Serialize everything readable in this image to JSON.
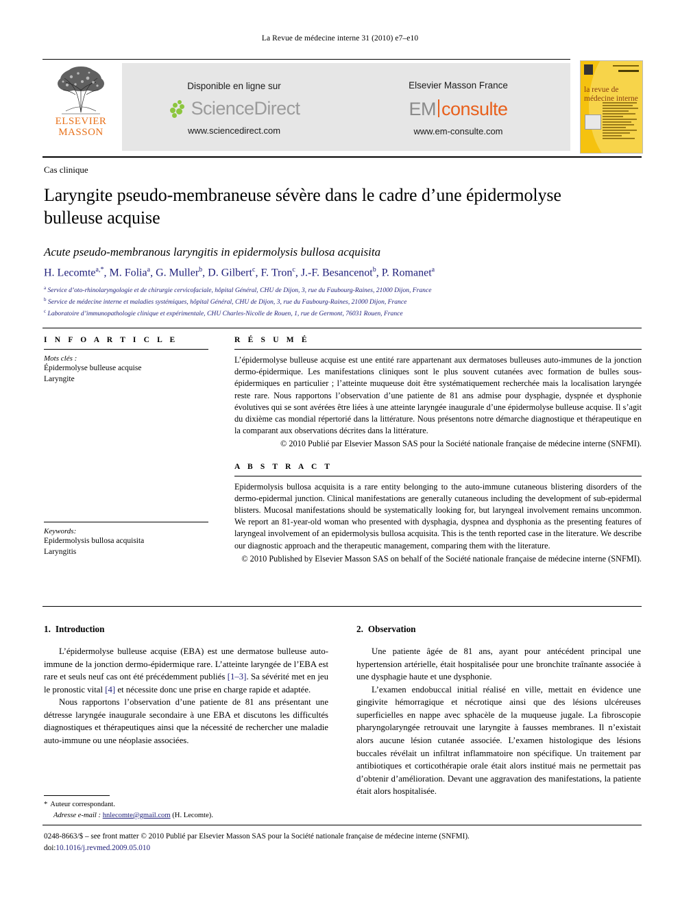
{
  "running_head": "La Revue de médecine interne 31 (2010) e7–e10",
  "banner": {
    "publisher_line1": "ELSEVIER",
    "publisher_line2": "MASSON",
    "sciencedirect": {
      "caption": "Disponible en ligne sur",
      "wordmark": "ScienceDirect",
      "url": "www.sciencedirect.com"
    },
    "emconsulte": {
      "caption": "Elsevier Masson France",
      "wordmark_left": "EM",
      "wordmark_right": "consulte",
      "url": "www.em-consulte.com"
    },
    "cover": {
      "title_line1": "la revue de",
      "title_line2": "médecine interne"
    }
  },
  "article": {
    "type": "Cas clinique",
    "title_fr": "Laryngite pseudo-membraneuse sévère dans le cadre d’une épidermolyse bulleuse acquise",
    "title_en": "Acute pseudo-membranous laryngitis in epidermolysis bullosa acquisita",
    "authors_html": "H. Lecomte<sup>a,*</sup>, M. Folia<sup>a</sup>, G. Muller<sup>b</sup>, D. Gilbert<sup>c</sup>, F. Tron<sup>c</sup>, J.-F. Besancenot<sup>b</sup>, P. Romanet<sup>a</sup>",
    "affiliations": [
      {
        "mark": "a",
        "text": "Service d’oto-rhinolaryngologie et de chirurgie cervicofaciale, hôpital Général, CHU de Dijon, 3, rue du Faubourg-Raines, 21000 Dijon, France"
      },
      {
        "mark": "b",
        "text": "Service de médecine interne et maladies systémiques, hôpital Général, CHU de Dijon, 3, rue du Faubourg-Raines, 21000 Dijon, France"
      },
      {
        "mark": "c",
        "text": "Laboratoire d’immunopathologie clinique et expérimentale, CHU Charles-Nicolle de Rouen, 1, rue de Germont, 76031 Rouen, France"
      }
    ]
  },
  "info_article": {
    "heading": "I N F O   A R T I C L E",
    "keywords_fr_label": "Mots clés :",
    "keywords_fr": [
      "Épidermolyse bulleuse acquise",
      "Laryngite"
    ],
    "keywords_en_label": "Keywords:",
    "keywords_en": [
      "Epidermolysis bullosa acquisita",
      "Laryngitis"
    ]
  },
  "resume": {
    "heading": "R É S U M É",
    "body": "L’épidermolyse bulleuse acquise est une entité rare appartenant aux dermatoses bulleuses auto-immunes de la jonction dermo-épidermique. Les manifestations cliniques sont le plus souvent cutanées avec formation de bulles sous-épidermiques en particulier ; l’atteinte muqueuse doit être systématiquement recherchée mais la localisation laryngée reste rare. Nous rapportons l’observation d’une patiente de 81 ans admise pour dysphagie, dyspnée et dysphonie évolutives qui se sont avérées être liées à une atteinte laryngée inaugurale d’une épidermolyse bulleuse acquise. Il s’agit du dixième cas mondial répertorié dans la littérature. Nous présentons notre démarche diagnostique et thérapeutique en la comparant aux observations décrites dans la littérature.",
    "copyright": "© 2010 Publié par Elsevier Masson SAS pour la Société nationale française de médecine interne (SNFMI)."
  },
  "abstract": {
    "heading": "A B S T R A C T",
    "body": "Epidermolysis bullosa acquisita is a rare entity belonging to the auto-immune cutaneous blistering disorders of the dermo-epidermal junction. Clinical manifestations are generally cutaneous including the development of sub-epidermal blisters. Mucosal manifestations should be systematically looking for, but laryngeal involvement remains uncommon. We report an 81-year-old woman who presented with dysphagia, dyspnea and dysphonia as the presenting features of laryngeal involvement of an epidermolysis bullosa acquisita. This is the tenth reported case in the literature. We describe our diagnostic approach and the therapeutic management, comparing them with the literature.",
    "copyright": "© 2010 Published by Elsevier Masson SAS on behalf of the Société nationale française de médecine interne (SNFMI)."
  },
  "sections": {
    "introduction": {
      "number": "1.",
      "title": "Introduction",
      "paragraph1_pre": "L’épidermolyse bulleuse acquise (EBA) est une dermatose bulleuse auto-immune de la jonction dermo-épidermique rare. L’atteinte laryngée de l’EBA est rare et seuls neuf cas ont été précédemment publiés ",
      "ref1": "[1–3]",
      "paragraph1_mid": ". Sa sévérité met en jeu le pronostic vital ",
      "ref2": "[4]",
      "paragraph1_post": " et nécessite donc une prise en charge rapide et adaptée.",
      "paragraph2": "Nous rapportons l’observation d’une patiente de 81 ans présentant une détresse laryngée inaugurale secondaire à une EBA et discutons les difficultés diagnostiques et thérapeutiques ainsi que la nécessité de rechercher une maladie auto-immune ou une néoplasie associées."
    },
    "observation": {
      "number": "2.",
      "title": "Observation",
      "paragraph1": "Une patiente âgée de 81 ans, ayant pour antécédent principal une hypertension artérielle, était hospitalisée pour une bronchite traînante associée à une dysphagie haute et une dysphonie.",
      "paragraph2": "L’examen endobuccal initial réalisé en ville, mettait en évidence une gingivite hémorragique et nécrotique ainsi que des lésions ulcéreuses superficielles en nappe avec sphacèle de la muqueuse jugale. La fibroscopie pharyngolaryngée retrouvait une laryngite à fausses membranes. Il n’existait alors aucune lésion cutanée associée. L’examen histologique des lésions buccales révélait un infiltrat inflammatoire non spécifique. Un traitement par antibiotiques et corticothérapie orale était alors institué mais ne permettait pas d’obtenir d’amélioration. Devant une aggravation des manifestations, la patiente était alors hospitalisée."
    }
  },
  "footnote": {
    "star": "*",
    "corresponding": "Auteur correspondant.",
    "email_label": "Adresse e-mail :",
    "email": "hnlecomte@gmail.com",
    "email_owner": "(H. Lecomte)."
  },
  "bottom": {
    "issn_line": "0248-8663/$ – see front matter © 2010 Publié par Elsevier Masson SAS pour la Société nationale française de médecine interne (SNFMI).",
    "doi_label": "doi:",
    "doi": "10.1016/j.revmed.2009.05.010"
  },
  "colors": {
    "link": "#20207a",
    "elsevier_orange": "#E8711A",
    "sciencedirect_green": "#8cc63e",
    "emconsulte_orange": "#e8601c",
    "cover_yellow": "#f5c20f",
    "banner_grey": "#e6e6e6"
  }
}
